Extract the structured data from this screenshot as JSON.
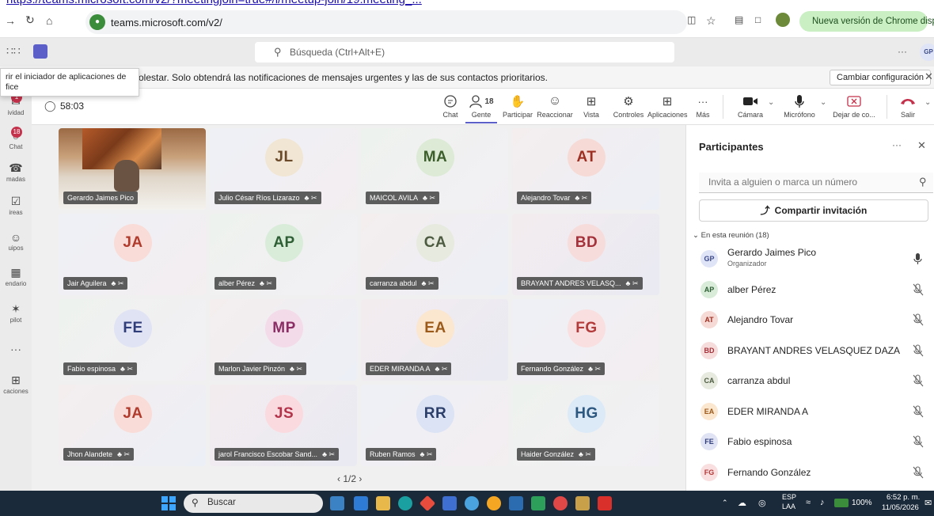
{
  "browser": {
    "top_link": "https://teams.microsoft.com/v2/?meetingjoin=true#/l/meetup-join/19:meeting_...",
    "url": "teams.microsoft.com/v2/",
    "update_label": "Nueva versión de Chrome disponible",
    "profile": "GP"
  },
  "teams": {
    "search_placeholder": "Búsqueda (Ctrl+Alt+E)",
    "more": "···"
  },
  "notification": {
    "message": "olestar. Solo obtendrá las notificaciones de mensajes urgentes y las de sus contactos prioritarios.",
    "button": "Cambiar configuración"
  },
  "tooltip": {
    "line1": "rir el iniciador de aplicaciones de",
    "line2": "fice"
  },
  "rail": [
    {
      "label": "ividad",
      "badge": "1"
    },
    {
      "label": "Chat",
      "badge": "18"
    },
    {
      "label": "madas",
      "badge": ""
    },
    {
      "label": "ireas",
      "badge": ""
    },
    {
      "label": "uipos",
      "badge": ""
    },
    {
      "label": "endario",
      "badge": ""
    },
    {
      "label": "pilot",
      "badge": ""
    },
    {
      "label": "···",
      "badge": ""
    },
    {
      "label": "caciones",
      "badge": ""
    }
  ],
  "meeting": {
    "timer": "58:03",
    "people_count": "18",
    "toolbar": {
      "chat": "Chat",
      "people": "Gente",
      "raise": "Participar",
      "react": "Reaccionar",
      "view": "Vista",
      "controls": "Controles",
      "apps": "Aplicaciones",
      "more": "Más",
      "camera": "Cámara",
      "mic": "Micrófono",
      "share": "Dejar de co...",
      "leave": "Salir"
    }
  },
  "tiles": [
    {
      "initials": "",
      "name": "Gerardo Jaimes Pico",
      "video": true
    },
    {
      "initials": "JL",
      "name": "Julio César Ríos Lizarazo",
      "video": false
    },
    {
      "initials": "MA",
      "name": "MAICOL AVILA",
      "video": false
    },
    {
      "initials": "AT",
      "name": "Alejandro Tovar",
      "video": false
    },
    {
      "initials": "JA",
      "name": "Jair Aguilera",
      "video": false
    },
    {
      "initials": "AP",
      "name": "alber Pérez",
      "video": false
    },
    {
      "initials": "CA",
      "name": "carranza abdul",
      "video": false
    },
    {
      "initials": "BD",
      "name": "BRAYANT ANDRES VELASQ...",
      "video": false
    },
    {
      "initials": "FE",
      "name": "Fabio espinosa",
      "video": false
    },
    {
      "initials": "MP",
      "name": "Marlon Javier Pinzón",
      "video": false
    },
    {
      "initials": "EA",
      "name": "EDER MIRANDA A",
      "video": false
    },
    {
      "initials": "FG",
      "name": "Fernando González",
      "video": false
    },
    {
      "initials": "JA",
      "name": "Jhon Alandete",
      "video": false
    },
    {
      "initials": "JS",
      "name": "jarol Francisco Escobar Sand...",
      "video": false
    },
    {
      "initials": "RR",
      "name": "Ruben Ramos",
      "video": false
    },
    {
      "initials": "HG",
      "name": "Haider González",
      "video": false
    }
  ],
  "pager": "‹  1/2  ›",
  "panel": {
    "title": "Participantes",
    "invite_placeholder": "Invita a alguien o marca un número",
    "share_invite": "Compartir invitación",
    "section": "En esta reunión (18)",
    "people": [
      {
        "initials": "GP",
        "name": "Gerardo Jaimes Pico",
        "role": "Organizador",
        "muted": false
      },
      {
        "initials": "AP",
        "name": "alber Pérez",
        "role": "",
        "muted": true
      },
      {
        "initials": "AT",
        "name": "Alejandro Tovar",
        "role": "",
        "muted": true
      },
      {
        "initials": "BD",
        "name": "BRAYANT ANDRES VELASQUEZ DAZA",
        "role": "",
        "muted": true
      },
      {
        "initials": "CA",
        "name": "carranza abdul",
        "role": "",
        "muted": true
      },
      {
        "initials": "EA",
        "name": "EDER MIRANDA A",
        "role": "",
        "muted": true
      },
      {
        "initials": "FE",
        "name": "Fabio espinosa",
        "role": "",
        "muted": true
      },
      {
        "initials": "FG",
        "name": "Fernando González",
        "role": "",
        "muted": true
      }
    ]
  },
  "taskbar": {
    "search": "Buscar",
    "lang1": "ESP",
    "lang2": "LAA",
    "battery": "100%",
    "time": "6:52 p. m.",
    "date": "11/05/2026"
  },
  "colors": {
    "accent": "#5b5fc7",
    "leave": "#c4314b",
    "avatars": {
      "JL": [
        "#f1e6d4",
        "#6b4a2a"
      ],
      "MA": [
        "#dcead6",
        "#3b5e2b"
      ],
      "AT": [
        "#f6dad6",
        "#9c2f22"
      ],
      "JA": [
        "#f9dcd7",
        "#b03b2d"
      ],
      "AP": [
        "#d9ecd9",
        "#2d5e34"
      ],
      "CA": [
        "#e6eadf",
        "#4d5b40"
      ],
      "BD": [
        "#f7dcdc",
        "#a3323a"
      ],
      "FE": [
        "#e0e3f4",
        "#2f3d7a"
      ],
      "MP": [
        "#f3dbe9",
        "#8a2d64"
      ],
      "EA": [
        "#fbe6cf",
        "#9b5a1a"
      ],
      "FG": [
        "#f9dfdf",
        "#b23a3a"
      ],
      "JS": [
        "#fbdadf",
        "#b2344a"
      ],
      "RR": [
        "#dbe3f4",
        "#2c3f6b"
      ],
      "HG": [
        "#dceaf7",
        "#2c577f"
      ],
      "GP": [
        "#dfe4f6",
        "#3c4a8a"
      ]
    }
  }
}
